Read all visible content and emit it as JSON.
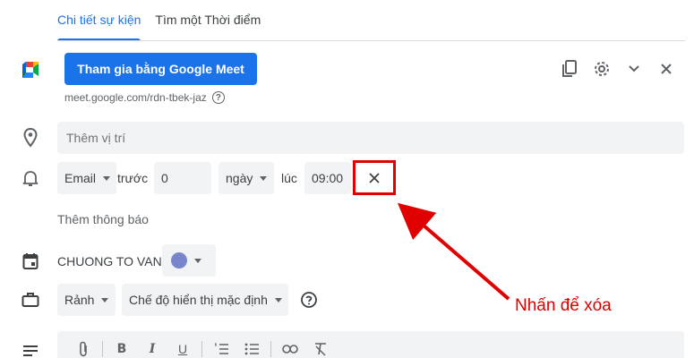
{
  "tabs": [
    {
      "label": "Chi tiết sự kiện",
      "active": true
    },
    {
      "label": "Tìm một Thời điểm",
      "active": false
    }
  ],
  "meet": {
    "button_label": "Tham gia bằng Google Meet",
    "link": "meet.google.com/rdn-tbek-jaz"
  },
  "location": {
    "placeholder": "Thêm vị trí"
  },
  "notification": {
    "method": "Email",
    "before_label": "trước",
    "amount": "0",
    "unit": "ngày",
    "at_label": "lúc",
    "time": "09:00"
  },
  "add_notification_label": "Thêm thông báo",
  "calendar": {
    "owner": "CHUONG TO VAN",
    "color": "#7986cb"
  },
  "availability": {
    "status": "Rảnh",
    "visibility": "Chế độ hiển thị mặc định"
  },
  "annotation": {
    "text": "Nhấn để xóa",
    "color": "#e00000"
  },
  "colors": {
    "accent": "#1a73e8",
    "field_bg": "#f1f3f4",
    "text": "#3c4043"
  },
  "icons": {
    "meet": "google-meet-icon",
    "help": "help-circle-icon",
    "copy": "copy-icon",
    "settings": "gear-icon",
    "expand": "chevron-down-icon",
    "close": "close-icon",
    "location": "map-pin-icon",
    "notification": "bell-icon",
    "remove": "close-icon",
    "calendar": "calendar-icon",
    "availability": "briefcase-icon",
    "description": "text-lines-icon"
  }
}
